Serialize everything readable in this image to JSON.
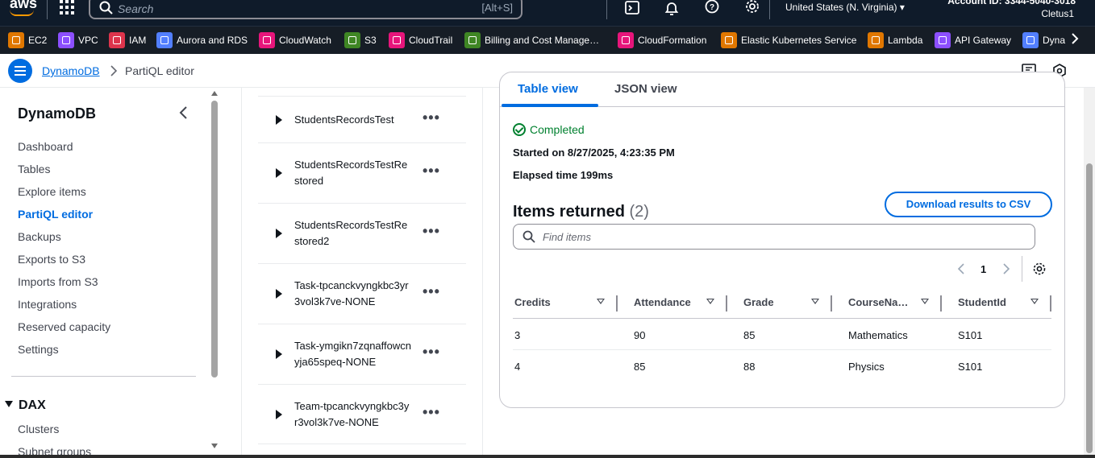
{
  "topbar": {
    "logo": "aws",
    "search_placeholder": "Search",
    "search_shortcut": "[Alt+S]",
    "region": "United States (N. Virginia)",
    "account": "Account ID: 3344-5040-3018",
    "user": "Cletus1",
    "icons": [
      "grid-icon",
      "cloudshell-icon",
      "bell-icon",
      "help-icon",
      "gear-icon"
    ]
  },
  "favorites": [
    {
      "label": "EC2",
      "color": "#e07700"
    },
    {
      "label": "VPC",
      "color": "#8c4fff"
    },
    {
      "label": "IAM",
      "color": "#dd344c"
    },
    {
      "label": "Aurora and RDS",
      "color": "#527fff"
    },
    {
      "label": "CloudWatch",
      "color": "#e7157b"
    },
    {
      "label": "S3",
      "color": "#3f8624"
    },
    {
      "label": "CloudTrail",
      "color": "#e7157b"
    },
    {
      "label": "Billing and Cost Manage…",
      "color": "#3f8624"
    },
    {
      "label": "CloudFormation",
      "color": "#e7157b"
    },
    {
      "label": "Elastic Kubernetes Service",
      "color": "#e07700"
    },
    {
      "label": "Lambda",
      "color": "#e07700"
    },
    {
      "label": "API Gateway",
      "color": "#8c4fff"
    },
    {
      "label": "Dyna",
      "color": "#527fff"
    }
  ],
  "breadcrumb": {
    "root": "DynamoDB",
    "current": "PartiQL editor"
  },
  "sidenav": {
    "title": "DynamoDB",
    "items": [
      {
        "label": "Dashboard",
        "active": false
      },
      {
        "label": "Tables",
        "active": false
      },
      {
        "label": "Explore items",
        "active": false
      },
      {
        "label": "PartiQL editor",
        "active": true
      },
      {
        "label": "Backups",
        "active": false
      },
      {
        "label": "Exports to S3",
        "active": false
      },
      {
        "label": "Imports from S3",
        "active": false
      },
      {
        "label": "Integrations",
        "active": false
      },
      {
        "label": "Reserved capacity",
        "active": false
      },
      {
        "label": "Settings",
        "active": false
      }
    ],
    "dax_title": "DAX",
    "dax_items": [
      "Clusters",
      "Subnet groups"
    ]
  },
  "tables": [
    "StudentsRecordsTest",
    "StudentsRecordsTestRestored",
    "StudentsRecordsTestRestored2",
    "Task-tpcanckvyngkbc3yr3vol3k7ve-NONE",
    "Task-ymgikn7zqnaffowcnyja65speq-NONE",
    "Team-tpcanckvyngkbc3yr3vol3k7ve-NONE"
  ],
  "more_actions": "•••",
  "results": {
    "tabs": [
      {
        "label": "Table view",
        "active": true
      },
      {
        "label": "JSON view",
        "active": false
      }
    ],
    "status": "Completed",
    "started": "Started on 8/27/2025, 4:23:35 PM",
    "elapsed": "Elapsed time 199ms",
    "items_title": "Items returned",
    "items_count": "(2)",
    "download_label": "Download results to CSV",
    "find_placeholder": "Find items",
    "page": "1",
    "columns": [
      "Credits",
      "Attendance",
      "Grade",
      "CourseNa…",
      "StudentId"
    ],
    "rows": [
      [
        "3",
        "90",
        "85",
        "Mathematics",
        "S101"
      ],
      [
        "4",
        "85",
        "88",
        "Physics",
        "S101"
      ]
    ]
  }
}
